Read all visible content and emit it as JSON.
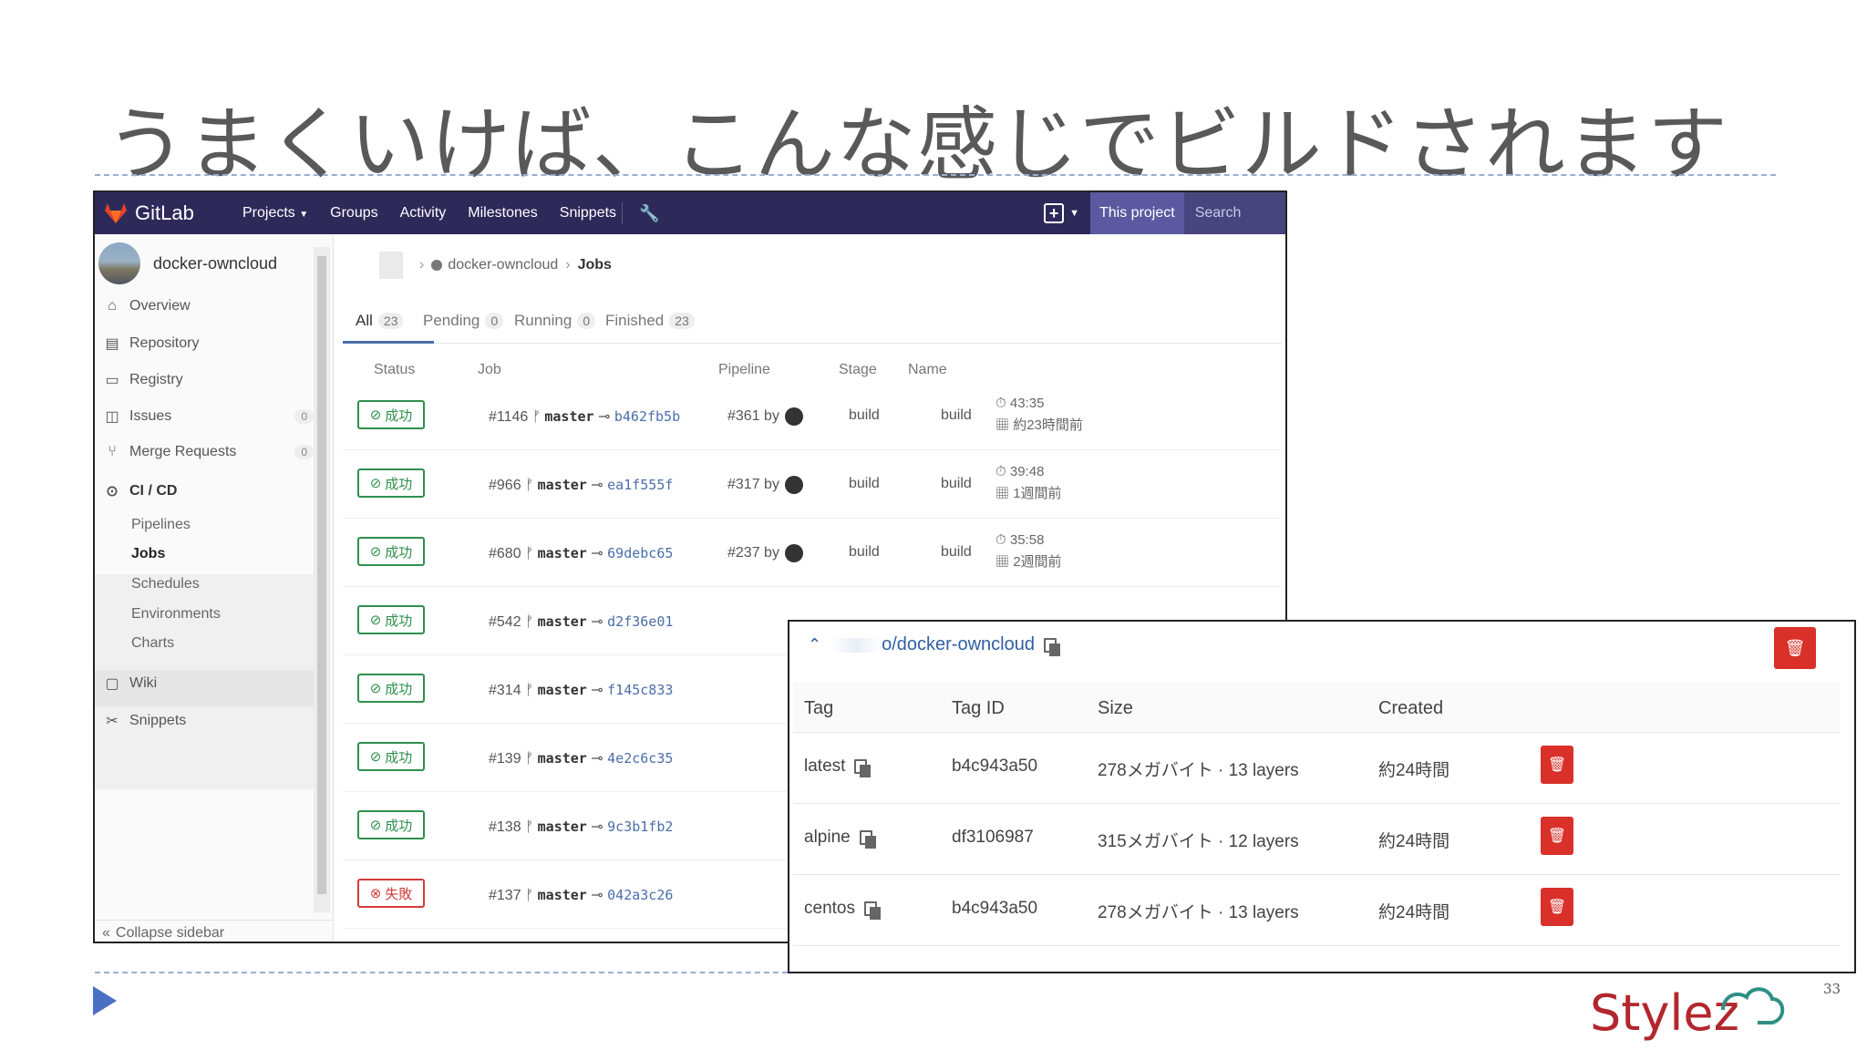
{
  "slide": {
    "title": "うまくいけば、こんな感じでビルドされます",
    "page_number": "33",
    "logo_text": "Stylez"
  },
  "gitlab": {
    "brand": "GitLab",
    "nav": [
      "Projects",
      "Groups",
      "Activity",
      "Milestones",
      "Snippets"
    ],
    "search_scope": "This project",
    "search_placeholder": "Search",
    "project_name": "docker-owncloud",
    "sidebar": [
      {
        "label": "Overview",
        "icon": "home-icon"
      },
      {
        "label": "Repository",
        "icon": "repository-icon"
      },
      {
        "label": "Registry",
        "icon": "registry-icon"
      },
      {
        "label": "Issues",
        "icon": "issues-icon",
        "count": "0"
      },
      {
        "label": "Merge Requests",
        "icon": "merge-request-icon",
        "count": "0"
      },
      {
        "label": "CI / CD",
        "icon": "rocket-icon"
      },
      {
        "label": "Wiki",
        "icon": "book-icon"
      },
      {
        "label": "Snippets",
        "icon": "scissors-icon"
      }
    ],
    "cicd_sub": [
      "Pipelines",
      "Jobs",
      "Schedules",
      "Environments",
      "Charts"
    ],
    "collapse_label": "Collapse sidebar",
    "breadcrumb": {
      "project": "docker-owncloud",
      "current": "Jobs"
    },
    "tabs": [
      {
        "label": "All",
        "count": "23"
      },
      {
        "label": "Pending",
        "count": "0"
      },
      {
        "label": "Running",
        "count": "0"
      },
      {
        "label": "Finished",
        "count": "23"
      }
    ],
    "columns": [
      "Status",
      "Job",
      "Pipeline",
      "Stage",
      "Name"
    ],
    "jobs": [
      {
        "status": "成功",
        "failed": false,
        "id": "#1146",
        "ref": "master",
        "sha": "b462fb5b",
        "pipeline": "#361 by",
        "stage": "build",
        "name": "build",
        "duration": "43:35",
        "when": "約23時間前"
      },
      {
        "status": "成功",
        "failed": false,
        "id": "#966",
        "ref": "master",
        "sha": "ea1f555f",
        "pipeline": "#317 by",
        "stage": "build",
        "name": "build",
        "duration": "39:48",
        "when": "1週間前"
      },
      {
        "status": "成功",
        "failed": false,
        "id": "#680",
        "ref": "master",
        "sha": "69debc65",
        "pipeline": "#237 by",
        "stage": "build",
        "name": "build",
        "duration": "35:58",
        "when": "2週間前"
      },
      {
        "status": "成功",
        "failed": false,
        "id": "#542",
        "ref": "master",
        "sha": "d2f36e01"
      },
      {
        "status": "成功",
        "failed": false,
        "id": "#314",
        "ref": "master",
        "sha": "f145c833"
      },
      {
        "status": "成功",
        "failed": false,
        "id": "#139",
        "ref": "master",
        "sha": "4e2c6c35"
      },
      {
        "status": "成功",
        "failed": false,
        "id": "#138",
        "ref": "master",
        "sha": "9c3b1fb2"
      },
      {
        "status": "失敗",
        "failed": true,
        "id": "#137",
        "ref": "master",
        "sha": "042a3c26"
      }
    ]
  },
  "registry": {
    "path": "o/docker-owncloud",
    "columns": [
      "Tag",
      "Tag ID",
      "Size",
      "Created"
    ],
    "tags": [
      {
        "tag": "latest",
        "tag_id": "b4c943a50",
        "size": "278メガバイト · 13 layers",
        "created": "約24時間"
      },
      {
        "tag": "alpine",
        "tag_id": "df3106987",
        "size": "315メガバイト · 12 layers",
        "created": "約24時間"
      },
      {
        "tag": "centos",
        "tag_id": "b4c943a50",
        "size": "278メガバイト · 13 layers",
        "created": "約24時間"
      }
    ]
  },
  "colors": {
    "nav": "#2d2a5a",
    "success": "#2e8f4e",
    "failed": "#d33c3c",
    "delete": "#d9302a",
    "link": "#2f5fa3"
  }
}
